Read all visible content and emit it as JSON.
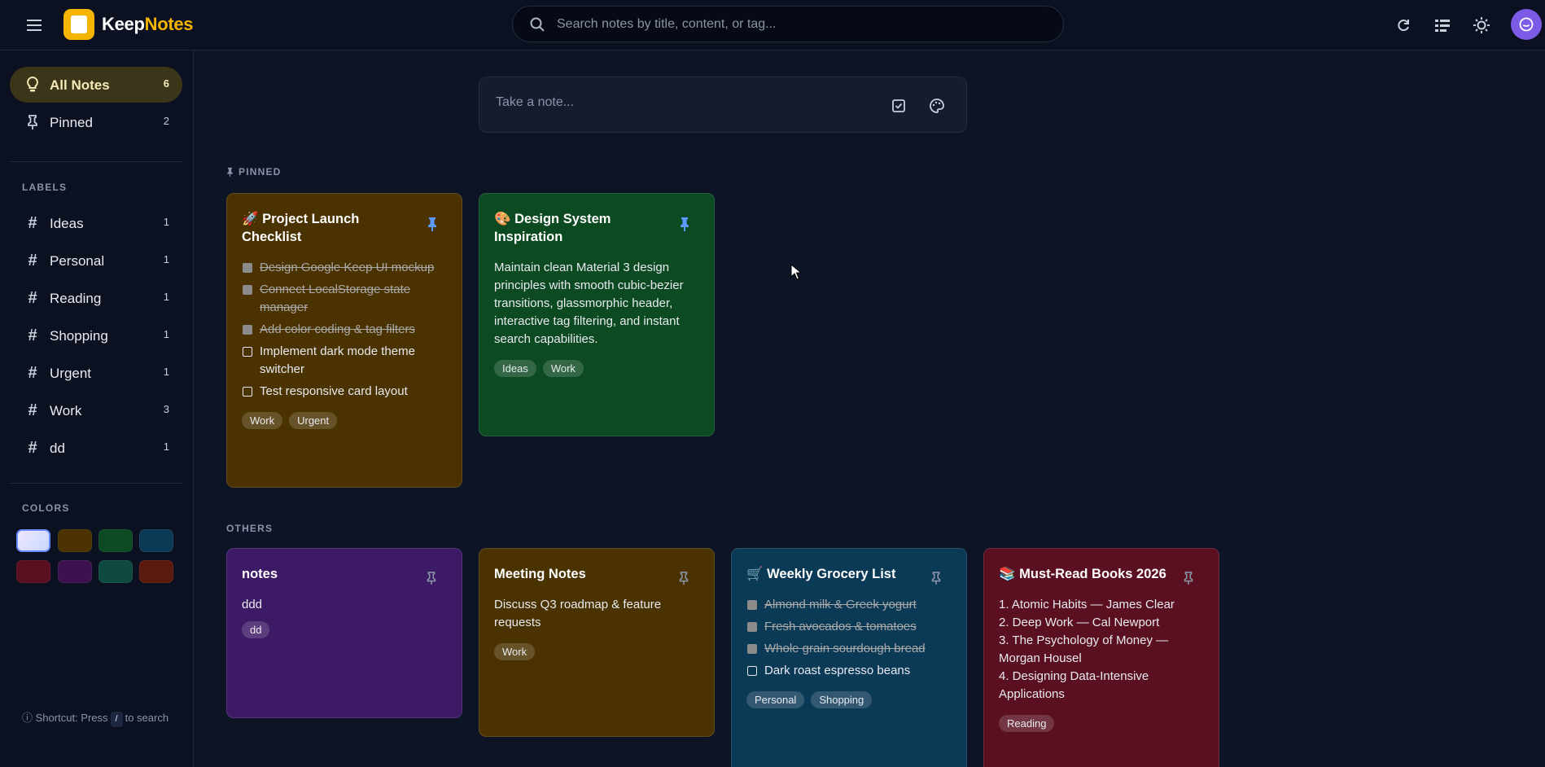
{
  "app": {
    "brand_a": "Keep",
    "brand_b": "Notes"
  },
  "search": {
    "placeholder": "Search notes by title, content, or tag..."
  },
  "header_icons": [
    "refresh-icon",
    "list-view-icon",
    "theme-sun-icon",
    "avatar-icon"
  ],
  "sidebar": {
    "nav": [
      {
        "label": "All Notes",
        "count": "6",
        "icon": "lightbulb-icon",
        "active": true
      },
      {
        "label": "Pinned",
        "count": "2",
        "icon": "pin-icon",
        "active": false
      }
    ],
    "labels_heading": "LABELS",
    "labels": [
      {
        "label": "Ideas",
        "count": "1"
      },
      {
        "label": "Personal",
        "count": "1"
      },
      {
        "label": "Reading",
        "count": "1"
      },
      {
        "label": "Shopping",
        "count": "1"
      },
      {
        "label": "Urgent",
        "count": "1"
      },
      {
        "label": "Work",
        "count": "3"
      },
      {
        "label": "dd",
        "count": "1"
      }
    ],
    "colors_heading": "COLORS",
    "colors": [
      "#e0d4ff",
      "#4a3300",
      "#0c4a22",
      "#0b3a56",
      "#5a1020",
      "#3d1150",
      "#0e4a40",
      "#5c1a0e"
    ],
    "shortcut_pre": "Shortcut: Press",
    "shortcut_key": "/",
    "shortcut_post": "to search"
  },
  "compose": {
    "placeholder": "Take a note..."
  },
  "groups": {
    "pinned": "PINNED",
    "others": "OTHERS"
  },
  "notes": {
    "launch": {
      "title": "🚀 Project Launch Checklist",
      "items": [
        {
          "text": "Design Google Keep UI mockup",
          "done": true
        },
        {
          "text": "Connect LocalStorage state manager",
          "done": true
        },
        {
          "text": "Add color coding & tag filters",
          "done": true
        },
        {
          "text": "Implement dark mode theme switcher",
          "done": false
        },
        {
          "text": "Test responsive card layout",
          "done": false
        }
      ],
      "tags": [
        "Work",
        "Urgent"
      ],
      "color": "#4a3300"
    },
    "design": {
      "title": "🎨 Design System Inspiration",
      "body": "Maintain clean Material 3 design principles with smooth cubic-bezier transitions, glassmorphic header, interactive tag filtering, and instant search capabilities.",
      "tags": [
        "Ideas",
        "Work"
      ],
      "color": "#0c4a22"
    },
    "notes": {
      "title": "notes",
      "body": "ddd",
      "tags": [
        "dd"
      ],
      "color": "#3d1a66"
    },
    "meeting": {
      "title": "Meeting Notes",
      "body": "Discuss Q3 roadmap & feature requests",
      "tags": [
        "Work"
      ],
      "color": "#4a3300"
    },
    "grocery": {
      "title": "🛒 Weekly Grocery List",
      "items": [
        {
          "text": "Almond milk & Greek yogurt",
          "done": true
        },
        {
          "text": "Fresh avocados & tomatoes",
          "done": true
        },
        {
          "text": "Whole grain sourdough bread",
          "done": true
        },
        {
          "text": "Dark roast espresso beans",
          "done": false
        }
      ],
      "tags": [
        "Personal",
        "Shopping"
      ],
      "color": "#0b3a56"
    },
    "books": {
      "title": "📚 Must-Read Books 2026",
      "body_lines": [
        "1. Atomic Habits — James Clear",
        "2. Deep Work — Cal Newport",
        "3. The Psychology of Money — Morgan Housel",
        "4. Designing Data-Intensive Applications"
      ],
      "tags": [
        "Reading"
      ],
      "color": "#5a1020"
    }
  }
}
